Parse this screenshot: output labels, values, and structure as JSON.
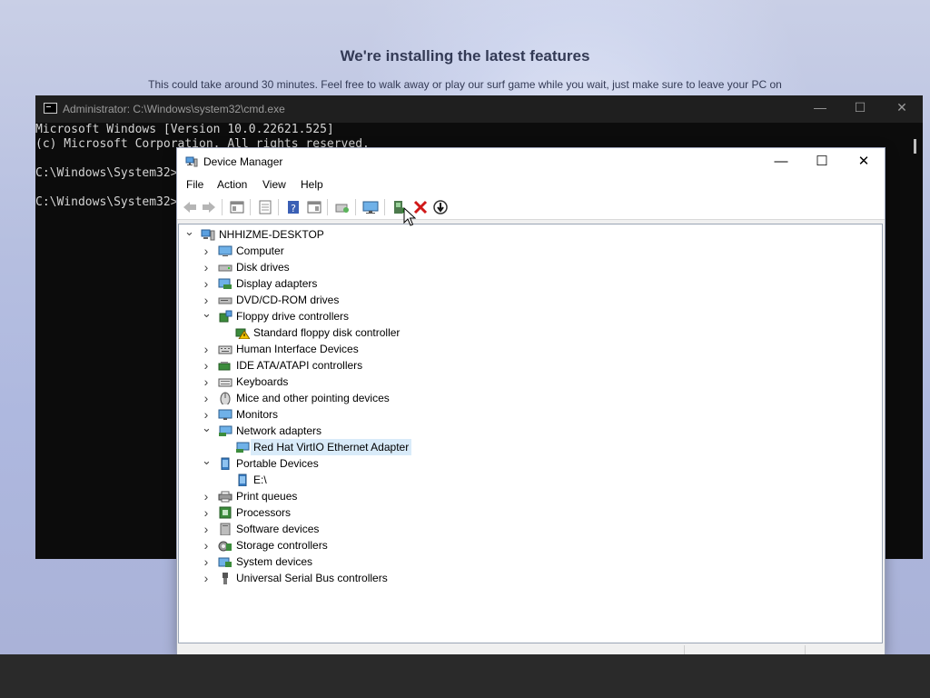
{
  "setup": {
    "title": "We're installing the latest features",
    "subtitle": "This could take around 30 minutes. Feel free to walk away or play our surf game while you wait, just make sure to leave your PC on"
  },
  "cmd": {
    "title": "Administrator: C:\\Windows\\system32\\cmd.exe",
    "minimize": "—",
    "maximize": "☐",
    "close": "✕",
    "lines": [
      "Microsoft Windows [Version 10.0.22621.525]",
      "(c) Microsoft Corporation. All rights reserved.",
      "",
      "C:\\Windows\\System32>",
      "",
      "C:\\Windows\\System32>"
    ]
  },
  "device_manager": {
    "title": "Device Manager",
    "minimize": "—",
    "maximize": "☐",
    "close": "✕",
    "menu": [
      "File",
      "Action",
      "View",
      "Help"
    ],
    "toolbar_icons": [
      "back-icon",
      "forward-icon",
      "properties-pane-icon",
      "show-hide-tree-icon",
      "help-icon",
      "action-pane-icon",
      "scan-hardware-icon",
      "monitor-icon",
      "update-driver-icon",
      "uninstall-icon",
      "disable-device-icon"
    ],
    "tree": [
      {
        "label": "NHHIZME-DESKTOP",
        "level": 0,
        "state": "expanded",
        "icon": "computer-root-icon"
      },
      {
        "label": "Computer",
        "level": 1,
        "state": "collapsed",
        "icon": "computer-icon"
      },
      {
        "label": "Disk drives",
        "level": 1,
        "state": "collapsed",
        "icon": "disk-drive-icon"
      },
      {
        "label": "Display adapters",
        "level": 1,
        "state": "collapsed",
        "icon": "display-adapter-icon"
      },
      {
        "label": "DVD/CD-ROM drives",
        "level": 1,
        "state": "collapsed",
        "icon": "dvd-drive-icon"
      },
      {
        "label": "Floppy drive controllers",
        "level": 1,
        "state": "expanded",
        "icon": "floppy-controller-icon"
      },
      {
        "label": "Standard floppy disk controller",
        "level": 2,
        "state": "leaf",
        "icon": "warning-device-icon"
      },
      {
        "label": "Human Interface Devices",
        "level": 1,
        "state": "collapsed",
        "icon": "hid-icon"
      },
      {
        "label": "IDE ATA/ATAPI controllers",
        "level": 1,
        "state": "collapsed",
        "icon": "ide-controller-icon"
      },
      {
        "label": "Keyboards",
        "level": 1,
        "state": "collapsed",
        "icon": "keyboard-icon"
      },
      {
        "label": "Mice and other pointing devices",
        "level": 1,
        "state": "collapsed",
        "icon": "mouse-icon"
      },
      {
        "label": "Monitors",
        "level": 1,
        "state": "collapsed",
        "icon": "monitor-icon"
      },
      {
        "label": "Network adapters",
        "level": 1,
        "state": "expanded",
        "icon": "network-adapter-icon"
      },
      {
        "label": "Red Hat VirtIO Ethernet Adapter",
        "level": 2,
        "state": "leaf",
        "icon": "network-adapter-icon",
        "selected": true
      },
      {
        "label": "Portable Devices",
        "level": 1,
        "state": "expanded",
        "icon": "portable-device-icon"
      },
      {
        "label": "E:\\",
        "level": 2,
        "state": "leaf",
        "icon": "portable-device-icon"
      },
      {
        "label": "Print queues",
        "level": 1,
        "state": "collapsed",
        "icon": "printer-icon"
      },
      {
        "label": "Processors",
        "level": 1,
        "state": "collapsed",
        "icon": "processor-icon"
      },
      {
        "label": "Software devices",
        "level": 1,
        "state": "collapsed",
        "icon": "software-device-icon"
      },
      {
        "label": "Storage controllers",
        "level": 1,
        "state": "collapsed",
        "icon": "storage-controller-icon"
      },
      {
        "label": "System devices",
        "level": 1,
        "state": "collapsed",
        "icon": "system-device-icon"
      },
      {
        "label": "Universal Serial Bus controllers",
        "level": 1,
        "state": "collapsed",
        "icon": "usb-icon"
      }
    ]
  },
  "colors": {
    "selection": "#d9ebf9",
    "cmd_bg": "#0c0c0c",
    "desktop_bg": "#b6bfe0",
    "taskbar": "#2a2a2a"
  }
}
